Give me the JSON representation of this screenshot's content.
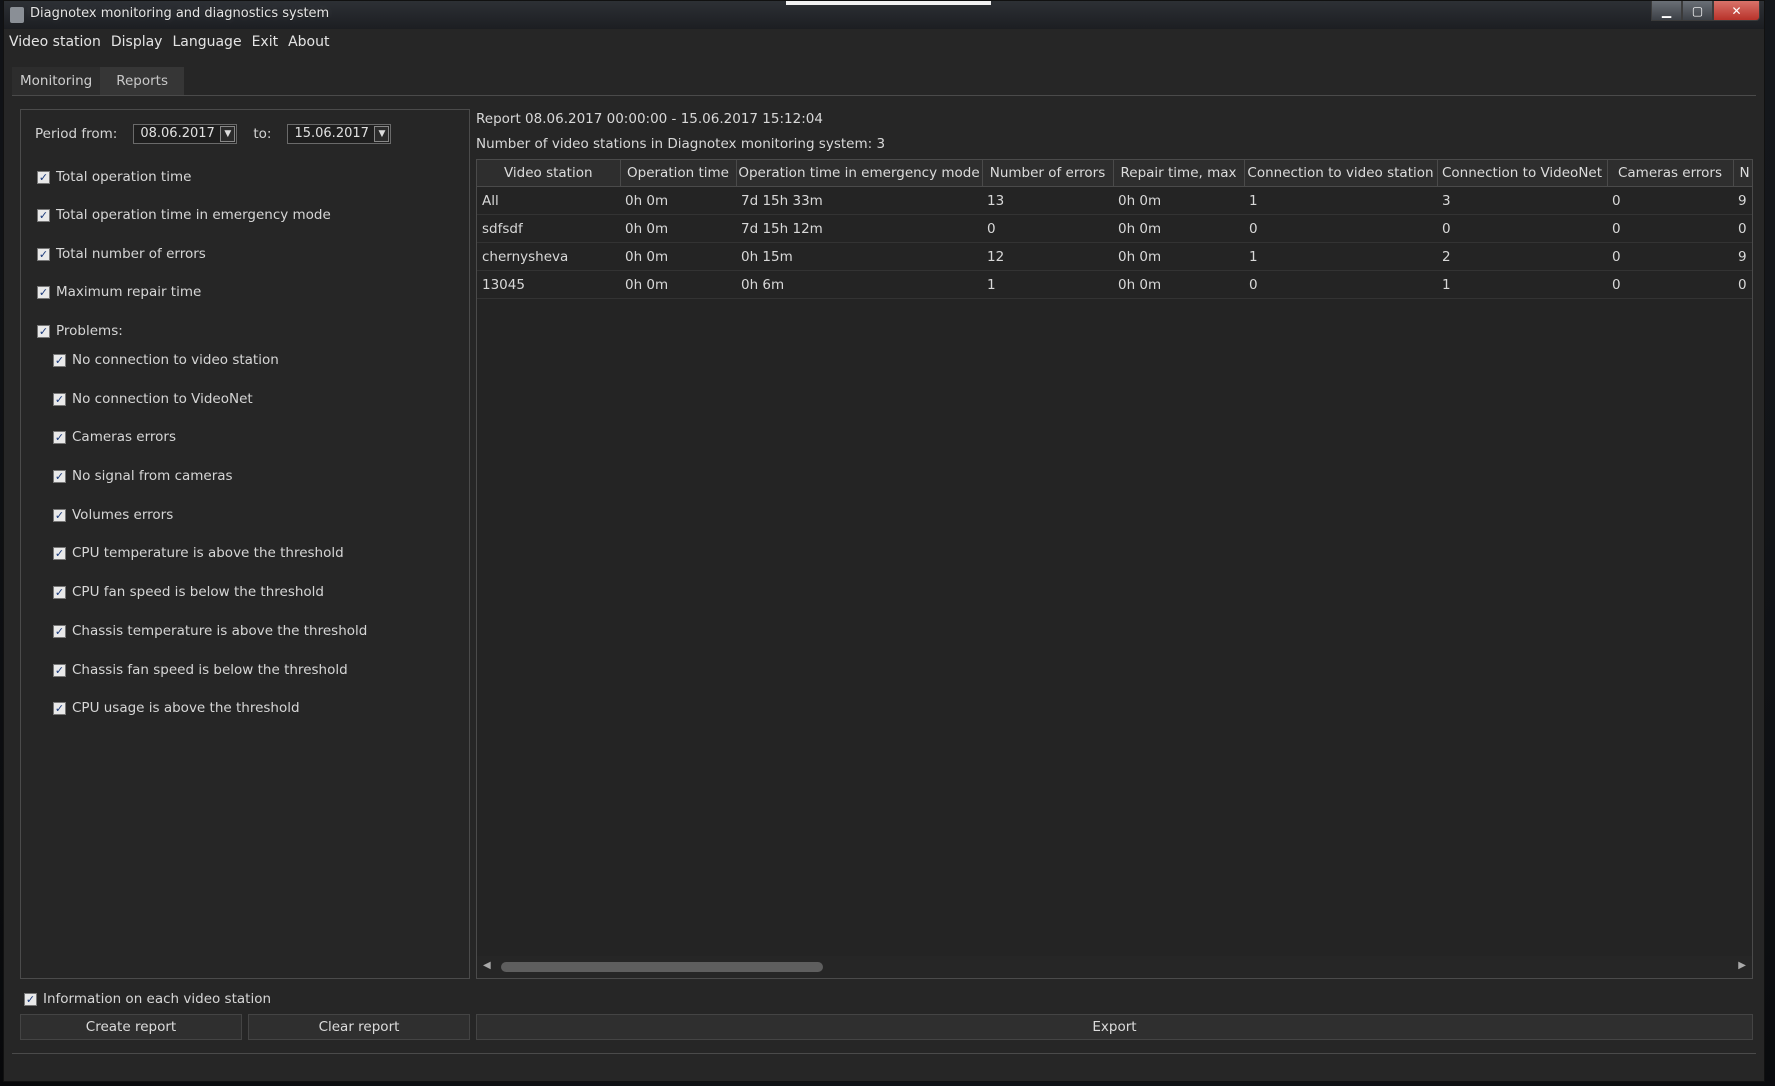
{
  "window": {
    "title": "Diagnotex monitoring and diagnostics system",
    "controls": {
      "minimize": "▁",
      "maximize": "▢",
      "close": "✕"
    }
  },
  "menu": [
    "Video station",
    "Display",
    "Language",
    "Exit",
    "About"
  ],
  "tabs": [
    {
      "label": "Monitoring",
      "active": true
    },
    {
      "label": "Reports",
      "active": false
    }
  ],
  "filters": {
    "period_from_label": "Period from:",
    "period_from_value": "08.06.2017",
    "to_label": "to:",
    "to_value": "15.06.2017",
    "dropdown_glyph": "▼",
    "options": [
      {
        "label": "Total operation time",
        "checked": true
      },
      {
        "label": "Total operation time in emergency mode",
        "checked": true
      },
      {
        "label": "Total number of errors",
        "checked": true
      },
      {
        "label": "Maximum repair time",
        "checked": true
      },
      {
        "label": "Problems:",
        "checked": true
      }
    ],
    "problems": [
      {
        "label": "No connection to video station",
        "checked": true
      },
      {
        "label": "No connection to VideoNet",
        "checked": true
      },
      {
        "label": "Cameras errors",
        "checked": true
      },
      {
        "label": "No signal from cameras",
        "checked": true
      },
      {
        "label": "Volumes errors",
        "checked": true
      },
      {
        "label": "CPU temperature is above the threshold",
        "checked": true
      },
      {
        "label": "CPU fan speed is below the threshold",
        "checked": true
      },
      {
        "label": "Chassis temperature is above the threshold",
        "checked": true
      },
      {
        "label": "Chassis fan speed is below the threshold",
        "checked": true
      },
      {
        "label": "CPU usage is above the threshold",
        "checked": true
      }
    ],
    "info_each": {
      "label": "Information on each video station",
      "checked": true
    },
    "check_glyph": "✓"
  },
  "report": {
    "title": "Report 08.06.2017 00:00:00 - 15.06.2017 15:12:04",
    "count_text": "Number of video stations in Diagnotex monitoring system: 3",
    "columns": [
      "Video station",
      "Operation time",
      "Operation time in emergency mode",
      "Number of errors",
      "Repair time, max",
      "Connection to video station",
      "Connection to VideoNet",
      "Cameras errors",
      "N"
    ],
    "rows": [
      [
        "All",
        "0h 0m",
        "7d 15h 33m",
        "13",
        "0h 0m",
        "1",
        "3",
        "0",
        "9"
      ],
      [
        "sdfsdf",
        "0h 0m",
        "7d 15h 12m",
        "0",
        "0h 0m",
        "0",
        "0",
        "0",
        "0"
      ],
      [
        "chernysheva",
        "0h 0m",
        "0h 15m",
        "12",
        "0h 0m",
        "1",
        "2",
        "0",
        "9"
      ],
      [
        "13045",
        "0h 0m",
        "0h 6m",
        "1",
        "0h 0m",
        "0",
        "1",
        "0",
        "0"
      ]
    ],
    "scroll": {
      "left_glyph": "◀",
      "right_glyph": "▶"
    }
  },
  "buttons": {
    "create": "Create report",
    "clear": "Clear report",
    "export": "Export"
  }
}
